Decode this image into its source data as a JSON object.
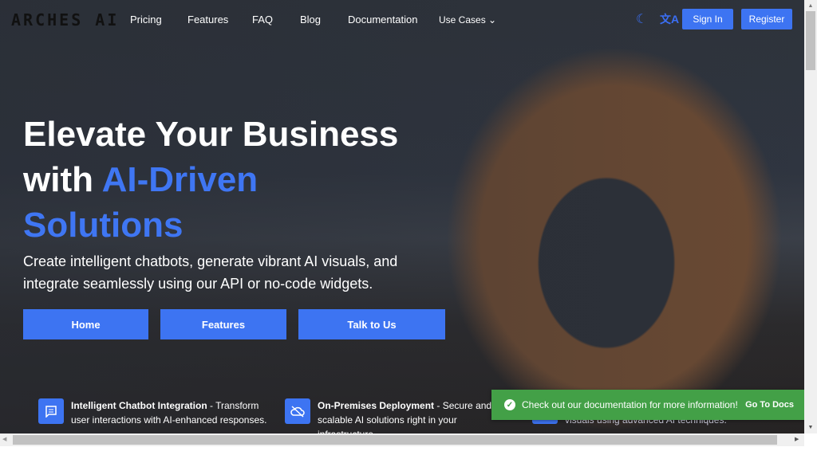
{
  "nav": {
    "logo": "ARCHES AI",
    "links": [
      "Pricing",
      "Features",
      "FAQ",
      "Blog",
      "Documentation",
      "Use Cases"
    ],
    "sign_in": "Sign In",
    "register": "Register",
    "icons": [
      "moon-icon",
      "translate-icon"
    ]
  },
  "hero": {
    "title_a": "Elevate Your Business",
    "title_b": "with ",
    "title_hl": "AI-Driven",
    "title_c": "Solutions",
    "subtitle": "Create intelligent chatbots, generate vibrant AI visuals, and integrate seamlessly using our API or no-code widgets.",
    "buttons": [
      "Home",
      "Features",
      "Talk to Us"
    ],
    "accent": "#3d74f2"
  },
  "features": [
    {
      "title": "Intelligent Chatbot Integration",
      "text": " - Transform user interactions with AI-enhanced responses."
    },
    {
      "title": "On-Premises Deployment",
      "text": " - Secure and scalable AI solutions right in your infrastructure."
    },
    {
      "text3": "visuals using advanced AI techniques."
    }
  ],
  "toast": {
    "message": "Check out our documentation for more information!",
    "action": "Go To Docs",
    "color": "#43a047"
  }
}
